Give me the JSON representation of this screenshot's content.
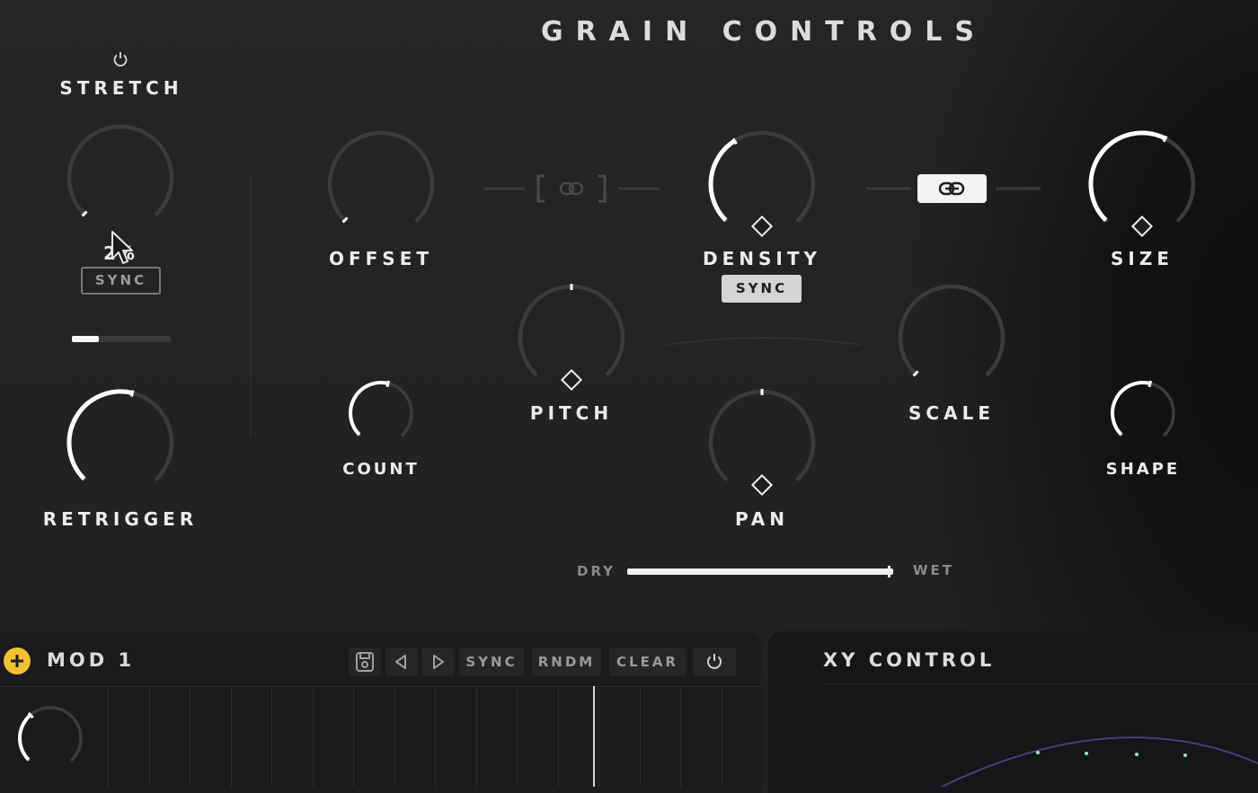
{
  "header": {
    "title": "GRAIN CONTROLS"
  },
  "stretch": {
    "label": "STRETCH",
    "value_text": "2%",
    "sync_label": "SYNC",
    "bar_fraction": 0.27,
    "knob_value": 0.0
  },
  "retrigger": {
    "label": "RETRIGGER",
    "knob_value": 0.55
  },
  "offset": {
    "label": "OFFSET",
    "knob_value": 0.0
  },
  "count": {
    "label": "COUNT",
    "knob_value": 0.55
  },
  "pitch": {
    "label": "PITCH",
    "knob_value": 0.5
  },
  "density": {
    "label": "DENSITY",
    "sync_label": "SYNC",
    "knob_value": 0.38
  },
  "pan": {
    "label": "PAN",
    "knob_value": 0.5
  },
  "scale": {
    "label": "SCALE",
    "knob_value": 0.0
  },
  "size": {
    "label": "SIZE",
    "knob_value": 0.6
  },
  "shape": {
    "label": "SHAPE",
    "knob_value": 0.55
  },
  "mix": {
    "dry_label": "DRY",
    "wet_label": "WET",
    "wet_fraction": 1.0
  },
  "mod": {
    "title": "MOD 1",
    "buttons": {
      "sync": "SYNC",
      "rndm": "RNDM",
      "clear": "CLEAR"
    },
    "icons": [
      "add-icon",
      "save-icon",
      "prev-icon",
      "next-icon",
      "power-icon"
    ]
  },
  "xy": {
    "title": "XY CONTROL"
  },
  "colors": {
    "accent_yellow": "#f2c12e",
    "arc_active": "#ffffff",
    "arc_track": "#3c3c3f",
    "background": "#222224"
  }
}
